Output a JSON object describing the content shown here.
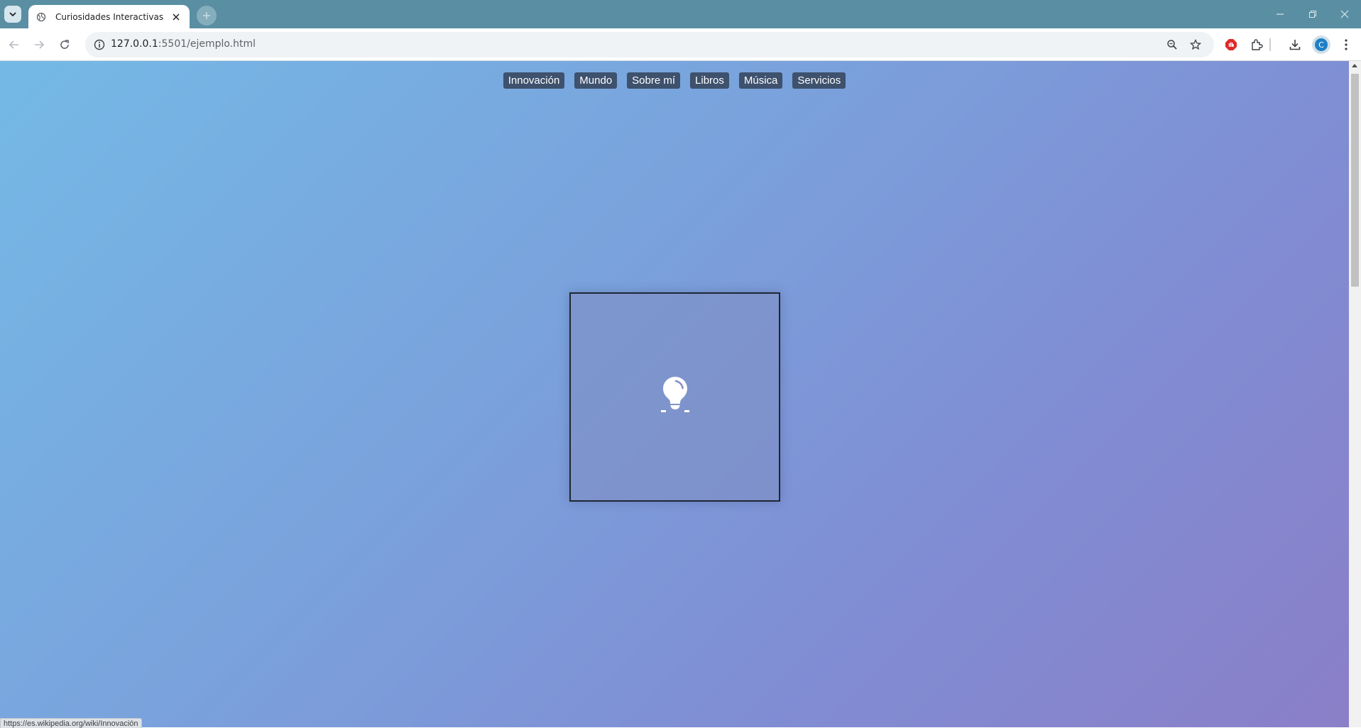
{
  "browser": {
    "tab_title": "Curiosidades Interactivas",
    "url_host": "127.0.0.1",
    "url_port_path": ":5501/ejemplo.html",
    "profile_initial": "C",
    "status_url": "https://es.wikipedia.org/wiki/Innovación"
  },
  "nav": {
    "items": [
      {
        "label": "Innovación"
      },
      {
        "label": "Mundo"
      },
      {
        "label": "Sobre mí"
      },
      {
        "label": "Libros"
      },
      {
        "label": "Música"
      },
      {
        "label": "Servicios"
      }
    ]
  },
  "card": {
    "icon": "lightbulb-icon"
  },
  "colors": {
    "nav_bg": "#3e516d",
    "gradient_start": "#74b9e6",
    "gradient_end": "#8a7fc8",
    "tabstrip": "#5a8fa3"
  }
}
